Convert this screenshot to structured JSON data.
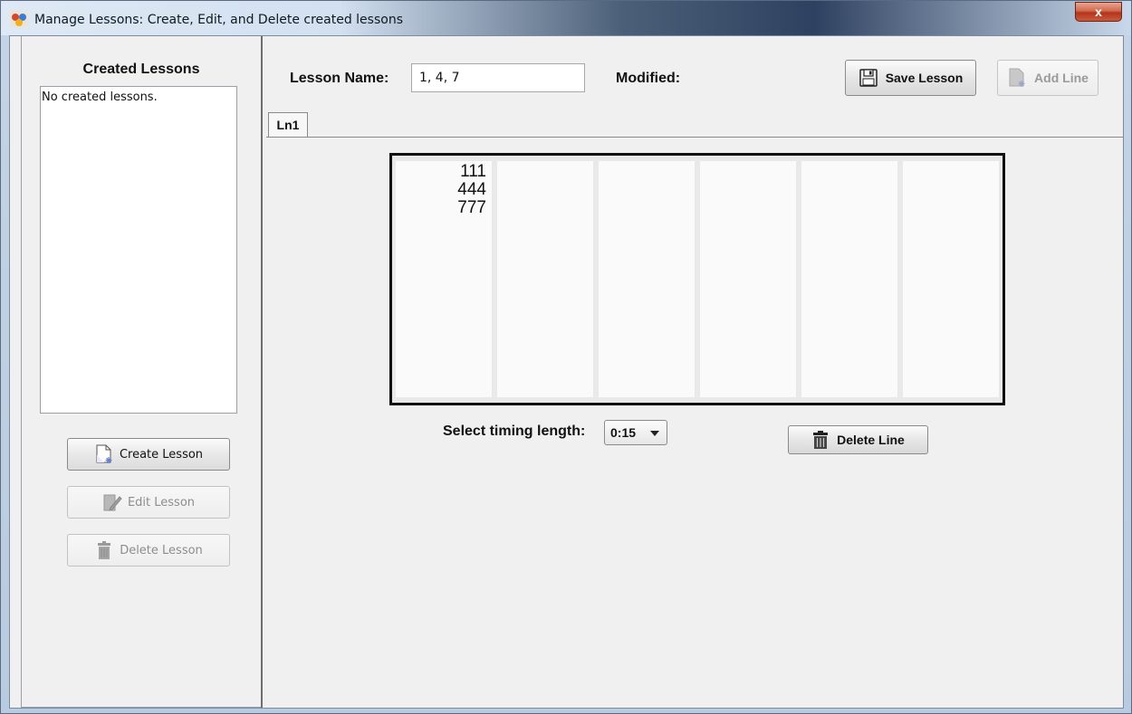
{
  "window": {
    "title": "Manage Lessons: Create, Edit, and Delete created lessons",
    "close_label": "x"
  },
  "sidebar": {
    "title": "Created Lessons",
    "empty_text": "No created lessons.",
    "buttons": [
      {
        "label": "Create Lesson",
        "icon": "new-document-icon",
        "enabled": true
      },
      {
        "label": "Edit Lesson",
        "icon": "edit-icon",
        "enabled": false
      },
      {
        "label": "Delete Lesson",
        "icon": "trash-icon",
        "enabled": false
      }
    ]
  },
  "header": {
    "lesson_name_label": "Lesson Name:",
    "lesson_name_value": "1, 4, 7",
    "modified_label": "Modified:",
    "save_label": "Save Lesson",
    "add_line_label": "Add Line"
  },
  "tabs": [
    {
      "label": "Ln1",
      "selected": true
    }
  ],
  "editor": {
    "columns": [
      {
        "values": [
          "111",
          "444",
          "777"
        ]
      },
      {
        "values": []
      },
      {
        "values": []
      },
      {
        "values": []
      },
      {
        "values": []
      },
      {
        "values": []
      }
    ]
  },
  "timing": {
    "label": "Select timing length:",
    "selected": "0:15"
  },
  "delete_line_label": "Delete Line"
}
